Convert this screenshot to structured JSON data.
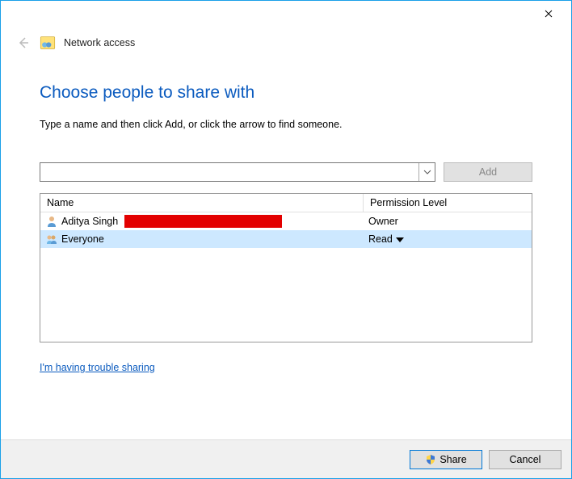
{
  "header": {
    "title": "Network access"
  },
  "main": {
    "heading": "Choose people to share with",
    "subtext": "Type a name and then click Add, or click the arrow to find someone.",
    "name_input": "",
    "name_placeholder": "",
    "add_label": "Add"
  },
  "grid": {
    "col_name": "Name",
    "col_perm": "Permission Level",
    "rows": [
      {
        "name": "Aditya Singh",
        "permission": "Owner",
        "selected": false,
        "type": "user",
        "perm_editable": false
      },
      {
        "name": "Everyone",
        "permission": "Read",
        "selected": true,
        "type": "group",
        "perm_editable": true
      }
    ]
  },
  "help_link": "I'm having trouble sharing",
  "footer": {
    "share": "Share",
    "cancel": "Cancel"
  }
}
